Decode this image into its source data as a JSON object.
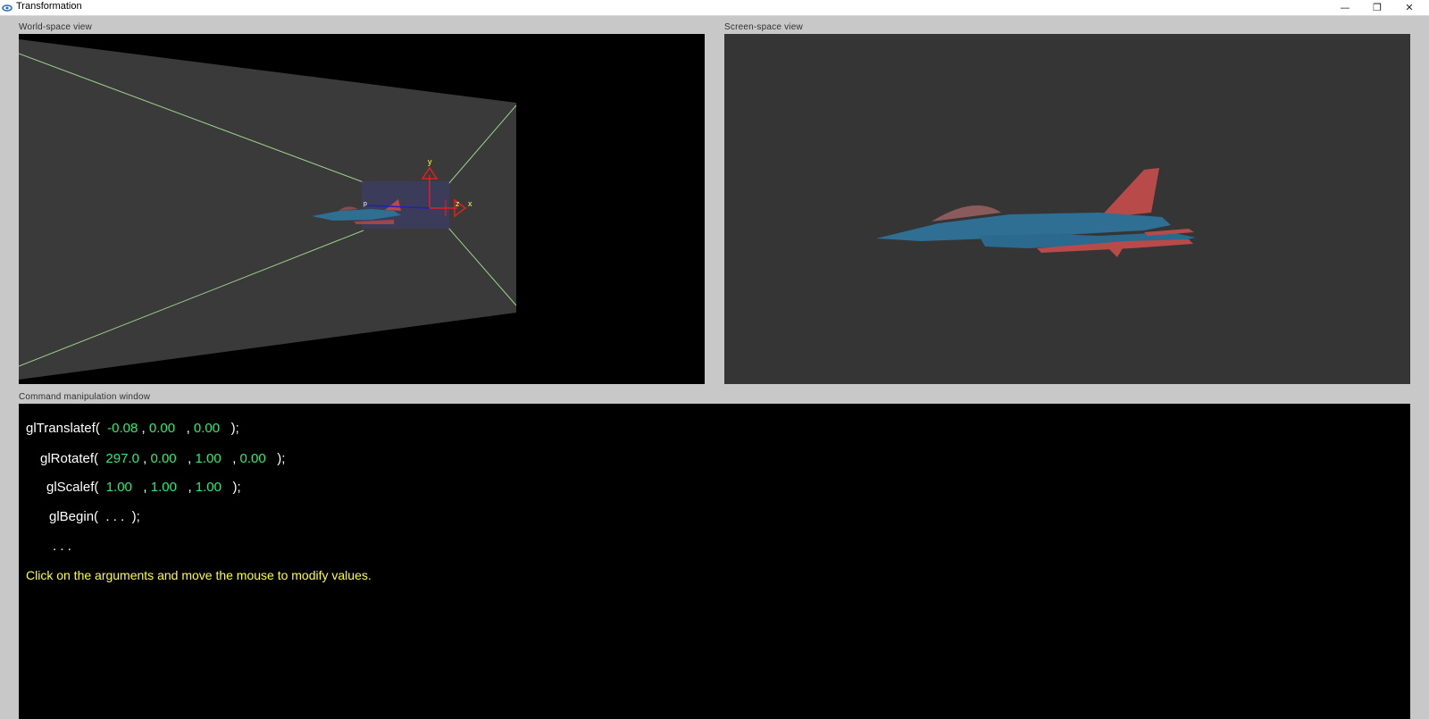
{
  "window": {
    "title": "Transformation",
    "controls": {
      "minimize": "—",
      "restore": "❐",
      "close": "✕"
    }
  },
  "world_view": {
    "label": "World-space view",
    "axis_labels": {
      "y": "y",
      "x": "x",
      "z": "z",
      "p": "p"
    }
  },
  "screen_view": {
    "label": "Screen-space view"
  },
  "command_window": {
    "label": "Command manipulation window",
    "translate": {
      "fn": "glTranslatef(",
      "args": [
        "-0.08",
        "0.00",
        "0.00"
      ],
      "end": ");"
    },
    "rotate": {
      "fn": "glRotatef(",
      "args": [
        "297.0",
        "0.00",
        "1.00",
        "0.00"
      ],
      "end": ");"
    },
    "scale": {
      "fn": "glScalef(",
      "args": [
        "1.00",
        "1.00",
        "1.00"
      ],
      "end": ");"
    },
    "begin": {
      "fn": "glBegin(",
      "args_text": ". . .",
      "end": ");"
    },
    "ellipsis": ". . .",
    "hint": "Click on the arguments and move the mouse to modify values."
  },
  "colors": {
    "background": "#c8c8c8",
    "view_black": "#000000",
    "frustum_gray": "#3a3a3a",
    "arg_green": "#22ee77",
    "hint_yellow": "#ffff22",
    "jet_blue": "#2f6f94",
    "jet_red": "#b84a4a"
  },
  "icons": {
    "app": "opengl-app-icon",
    "minimize": "minimize-icon",
    "restore": "restore-icon",
    "close": "close-icon"
  }
}
